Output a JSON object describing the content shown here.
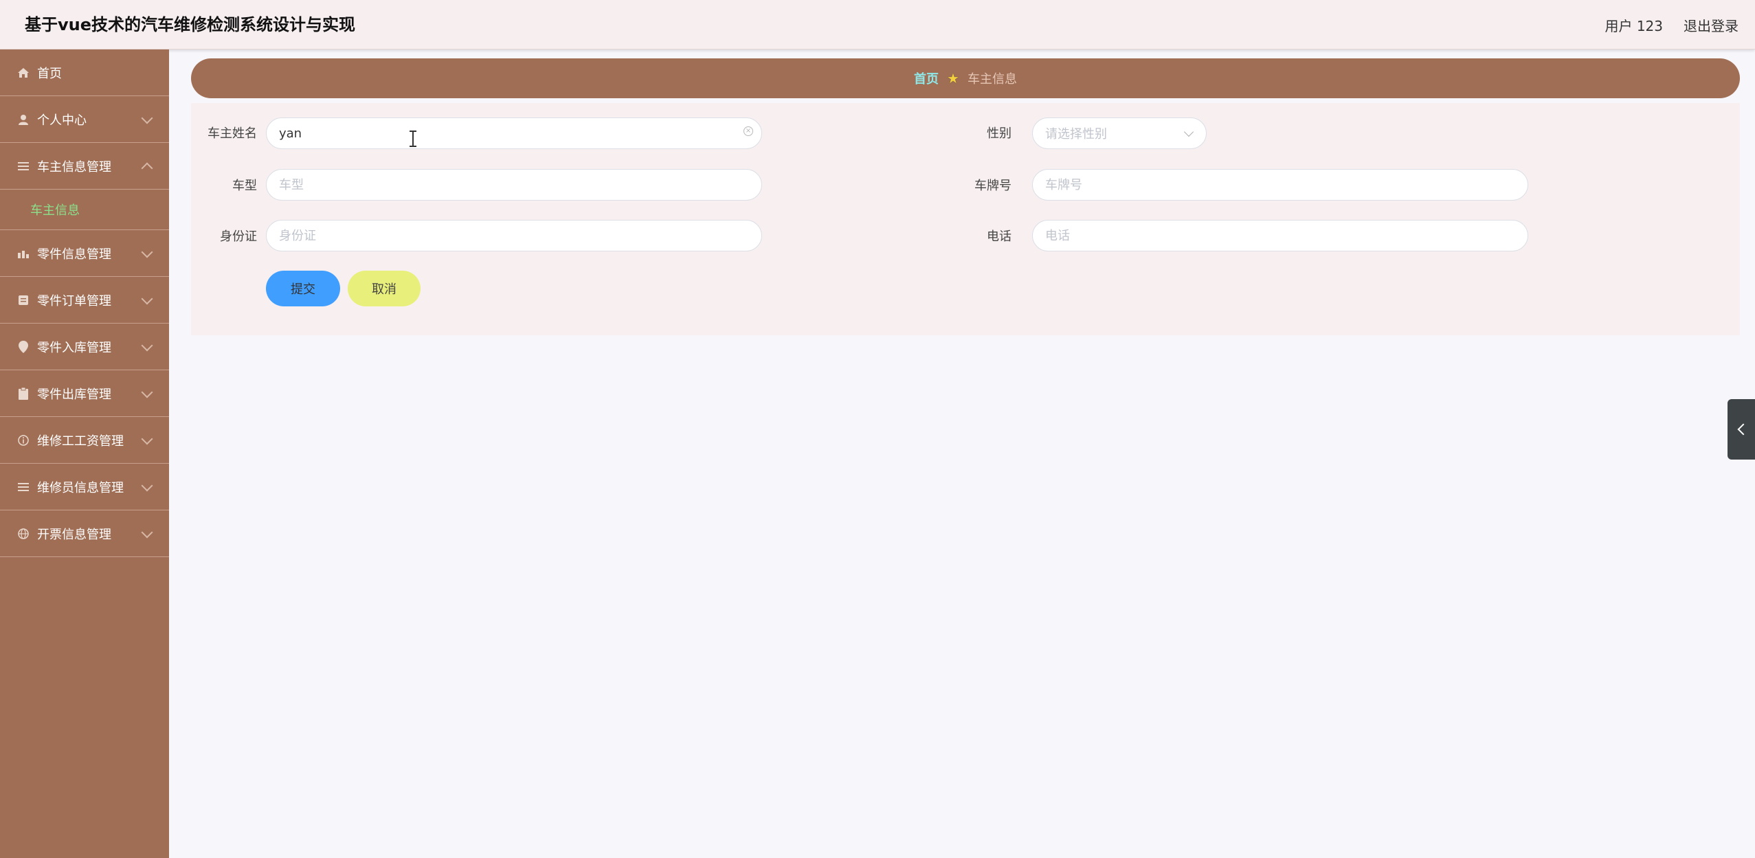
{
  "header": {
    "title": "基于vue技术的汽车维修检测系统设计与实现",
    "user_label": "用户 123",
    "logout_label": "退出登录"
  },
  "sidebar": {
    "items": [
      {
        "label": "首页",
        "icon": "home-icon"
      },
      {
        "label": "个人中心",
        "icon": "user-icon"
      },
      {
        "label": "车主信息管理",
        "icon": "menu-icon",
        "expanded": true,
        "children": [
          {
            "label": "车主信息",
            "active": true
          }
        ]
      },
      {
        "label": "零件信息管理",
        "icon": "chart-icon"
      },
      {
        "label": "零件订单管理",
        "icon": "order-icon"
      },
      {
        "label": "零件入库管理",
        "icon": "location-icon"
      },
      {
        "label": "零件出库管理",
        "icon": "clipboard-icon"
      },
      {
        "label": "维修工工资管理",
        "icon": "info-icon"
      },
      {
        "label": "维修员信息管理",
        "icon": "list-icon"
      },
      {
        "label": "开票信息管理",
        "icon": "globe-icon"
      }
    ]
  },
  "breadcrumb": {
    "home": "首页",
    "current": "车主信息"
  },
  "form": {
    "owner_name": {
      "label": "车主姓名",
      "value": "yan"
    },
    "gender": {
      "label": "性别",
      "placeholder": "请选择性别"
    },
    "car_model": {
      "label": "车型",
      "placeholder": "车型"
    },
    "plate": {
      "label": "车牌号",
      "placeholder": "车牌号"
    },
    "id_card": {
      "label": "身份证",
      "placeholder": "身份证"
    },
    "phone": {
      "label": "电话",
      "placeholder": "电话"
    },
    "submit_label": "提交",
    "cancel_label": "取消"
  },
  "colors": {
    "sidebar_bg": "#a06e55",
    "header_bg": "#f6eeef",
    "submit_bg": "#409eff",
    "cancel_bg": "#e8ef7a",
    "active_menu": "#8be08b"
  }
}
